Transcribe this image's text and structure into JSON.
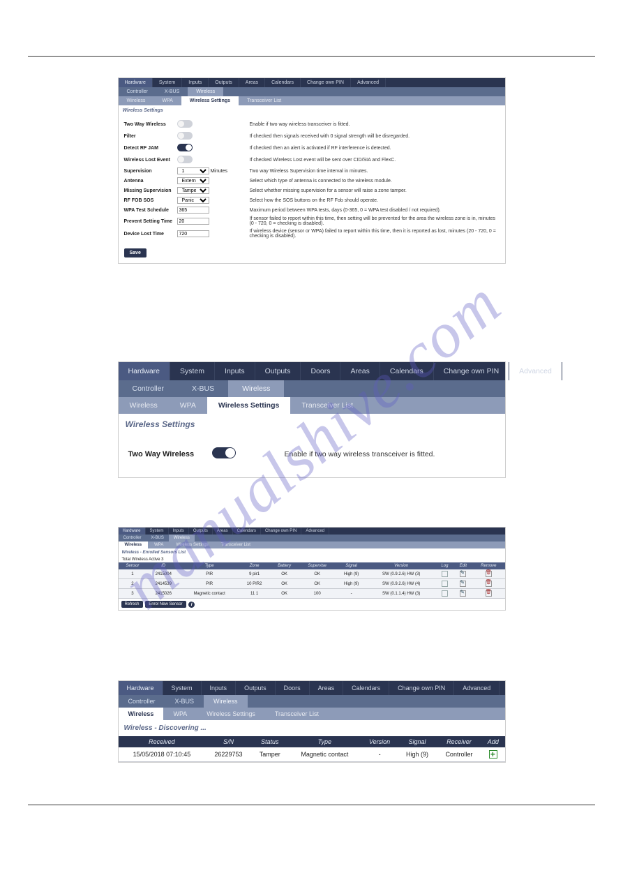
{
  "watermark": "manualshive.com",
  "nav": {
    "row1": [
      "Hardware",
      "System",
      "Inputs",
      "Outputs",
      "Areas",
      "Calendars",
      "Change own PIN",
      "Advanced"
    ],
    "row1b": [
      "Hardware",
      "System",
      "Inputs",
      "Outputs",
      "Doors",
      "Areas",
      "Calendars",
      "Change own PIN",
      "Advanced"
    ],
    "row2": [
      "Controller",
      "X-BUS",
      "Wireless"
    ],
    "row3": [
      "Wireless",
      "WPA",
      "Wireless Settings",
      "Transceiver List"
    ]
  },
  "p1": {
    "title": "Wireless Settings",
    "rows": [
      {
        "label": "Two Way Wireless",
        "ctrl": "toggle",
        "on": false,
        "desc": "Enable if two way wireless transceiver is fitted."
      },
      {
        "label": "Filter",
        "ctrl": "toggle",
        "on": false,
        "desc": "If checked then signals received with 0 signal strength will be disregarded."
      },
      {
        "label": "Detect RF JAM",
        "ctrl": "toggle",
        "on": true,
        "desc": "If checked then an alert is activated if RF interference is detected."
      },
      {
        "label": "Wireless Lost Event",
        "ctrl": "toggle",
        "on": false,
        "desc": "If checked Wireless Lost event will be sent over CID/SIA and FlexC."
      },
      {
        "label": "Supervision",
        "ctrl": "select",
        "value": "1",
        "unit": "Minutes",
        "desc": "Two way Wireless Supervision time interval in minutes."
      },
      {
        "label": "Antenna",
        "ctrl": "select",
        "value": "External",
        "desc": "Select which type of antenna is connected to the wireless module."
      },
      {
        "label": "Missing Supervision",
        "ctrl": "select",
        "value": "Tamper enabled",
        "desc": "Select whether missing supervision for a sensor will raise a zone tamper."
      },
      {
        "label": "RF FOB SOS",
        "ctrl": "select",
        "value": "Panic",
        "desc": "Select how the SOS buttons on the RF Fob should operate."
      },
      {
        "label": "WPA Test Schedule",
        "ctrl": "input",
        "value": "365",
        "desc": "Maximum period between WPA tests, days (0-365, 0 = WPA test disabled / not required)."
      },
      {
        "label": "Prevent Setting Time",
        "ctrl": "input",
        "value": "20",
        "desc": "If sensor failed to report within this time, then setting will be prevented for the area the wireless zone is in, minutes (0 - 720, 0 = checking is disabled)."
      },
      {
        "label": "Device Lost Time",
        "ctrl": "input",
        "value": "720",
        "desc": "If wireless device (sensor or WPA) failed to report within this time, then it is reported as lost, minutes (20 - 720, 0 = checking is disabled)."
      }
    ],
    "save": "Save"
  },
  "p2": {
    "title": "Wireless Settings",
    "row": {
      "label": "Two Way Wireless",
      "on": true,
      "desc": "Enable if two way wireless transceiver is fitted."
    }
  },
  "p3": {
    "title": "Wireless - Enrolled Sensors List",
    "subtitle": "Total Wireless Active 3",
    "cols": [
      "Sensor",
      "ID",
      "Type",
      "Zone",
      "Battery",
      "Supervise",
      "Signal",
      "Version",
      "Log",
      "Edit",
      "Remove"
    ],
    "rows": [
      {
        "sensor": "1",
        "id": "2415004",
        "type": "PIR",
        "zone": "9 pir1",
        "battery": "OK",
        "supervise": "OK",
        "signal": "High (9)",
        "version": "SW (0.9.2.6) HW (3)"
      },
      {
        "sensor": "2",
        "id": "2414539",
        "type": "PIR",
        "zone": "10 PIR2",
        "battery": "OK",
        "supervise": "OK",
        "signal": "High (9)",
        "version": "SW (0.9.2.6) HW (4)"
      },
      {
        "sensor": "3",
        "id": "2415026",
        "type": "Magnetic contact",
        "zone": "11 1",
        "battery": "OK",
        "supervise": "100",
        "signal": "-",
        "version": "SW (0.1.1.4) HW (3)"
      }
    ],
    "btn_refresh": "Refresh",
    "btn_enrol": "Enrol New Sensor"
  },
  "p4": {
    "title": "Wireless - Discovering ...",
    "cols": [
      "Received",
      "S/N",
      "Status",
      "Type",
      "Version",
      "Signal",
      "Receiver",
      "Add"
    ],
    "rows": [
      {
        "received": "15/05/2018 07:10:45",
        "sn": "26229753",
        "status": "Tamper",
        "type": "Magnetic contact",
        "version": "-",
        "signal": "High (9)",
        "receiver": "Controller"
      }
    ]
  }
}
